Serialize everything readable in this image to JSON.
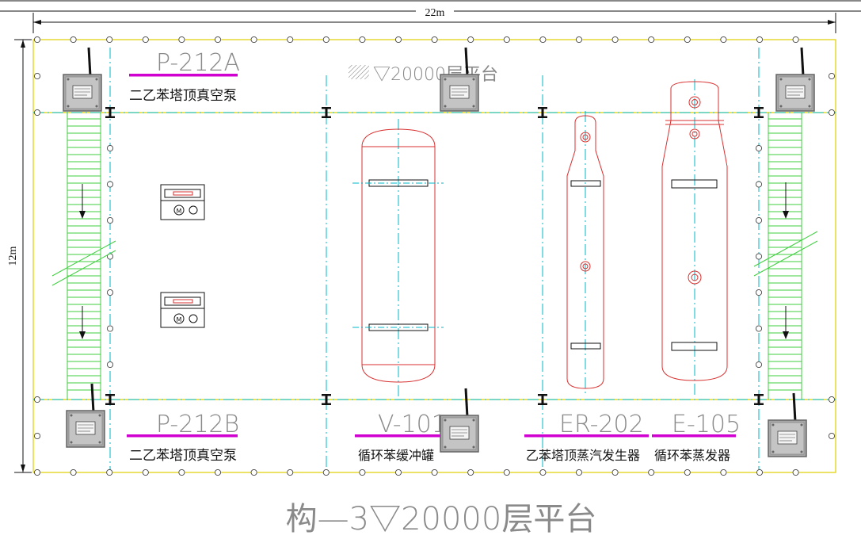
{
  "dimensions": {
    "width_label": "22m",
    "height_label": "12m"
  },
  "elevation_marker": "▽20000层平台",
  "equipment": [
    {
      "tag": "P-212A",
      "name": "二乙苯塔顶真空泵"
    },
    {
      "tag": "P-212B",
      "name": "二乙苯塔顶真空泵"
    },
    {
      "tag": "V-101",
      "name": "循环苯缓冲罐"
    },
    {
      "tag": "ER-202",
      "name": "乙苯塔顶蒸汽发生器"
    },
    {
      "tag": "E-105",
      "name": "循环苯蒸发器"
    }
  ],
  "drawing_title": "构—3▽20000层平台",
  "colors": {
    "grid": "#00b8c8",
    "vessel": "#d83030",
    "platform": "#e0d000",
    "stairs": "#3fcf3f",
    "underline": "#d000d0",
    "sensor_box": "#9a9a9a"
  },
  "icons": [
    "wireless-sensor-icon",
    "pump-motor-icon",
    "steel-column-icon",
    "down-arrow-icon",
    "hatch-icon"
  ]
}
